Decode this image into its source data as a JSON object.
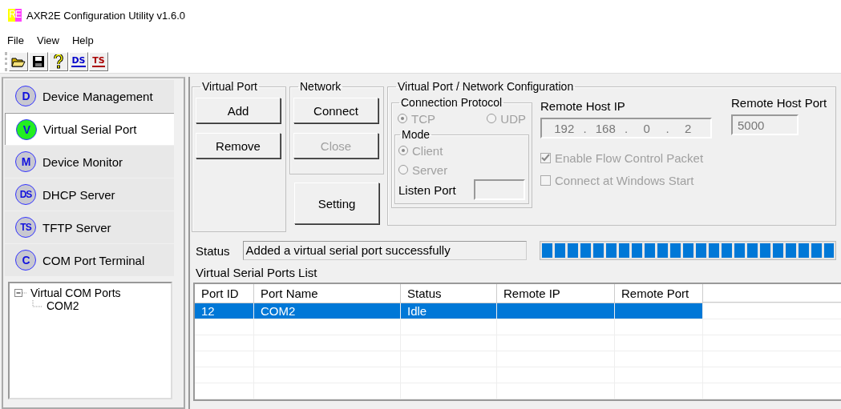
{
  "window": {
    "title": "AXR2E Configuration Utility v1.6.0",
    "logo": "RE"
  },
  "menu": [
    "File",
    "View",
    "Help"
  ],
  "toolbar": [
    {
      "kind": "open"
    },
    {
      "kind": "save"
    },
    {
      "kind": "help"
    },
    {
      "kind": "text",
      "label": "DS",
      "color": "#0000cc"
    },
    {
      "kind": "text",
      "label": "TS",
      "color": "#aa0000"
    }
  ],
  "sidebar": {
    "items": [
      {
        "badge": "D",
        "label": "Device Management",
        "selected": false
      },
      {
        "badge": "V",
        "label": "Virtual Serial Port",
        "selected": true
      },
      {
        "badge": "M",
        "label": "Device Monitor",
        "selected": false
      },
      {
        "badge": "DS",
        "label": "DHCP Server",
        "selected": false
      },
      {
        "badge": "TS",
        "label": "TFTP Server",
        "selected": false
      },
      {
        "badge": "C",
        "label": "COM Port Terminal",
        "selected": false
      }
    ],
    "tree": [
      {
        "label": "Virtual COM Ports",
        "expanded": true,
        "children": [
          {
            "label": "COM2"
          }
        ]
      }
    ]
  },
  "virtual_port": {
    "title": "Virtual Port",
    "buttons": [
      {
        "label": "Add",
        "disabled": false
      },
      {
        "label": "Remove",
        "disabled": false
      }
    ]
  },
  "network": {
    "title": "Network",
    "buttons": [
      {
        "label": "Connect",
        "disabled": false
      },
      {
        "label": "Close",
        "disabled": true
      }
    ],
    "setting_button": {
      "label": "Setting",
      "disabled": false
    }
  },
  "configuration": {
    "title": "Virtual Port / Network Configuration",
    "protocol": {
      "title": "Connection Protocol",
      "options": [
        {
          "label": "TCP",
          "selected": true,
          "disabled": true
        },
        {
          "label": "UDP",
          "selected": false,
          "disabled": true
        }
      ]
    },
    "mode": {
      "title": "Mode",
      "options": [
        {
          "label": "Client",
          "selected": true,
          "disabled": true
        },
        {
          "label": "Server",
          "selected": false,
          "disabled": true
        }
      ],
      "listen_port_label": "Listen Port"
    },
    "remote_host_ip": {
      "label": "Remote Host IP",
      "octets": [
        "192",
        "168",
        "0",
        "2"
      ],
      "separator": "."
    },
    "remote_host_port": {
      "label": "Remote Host Port",
      "value": "5000"
    },
    "checkboxes": [
      {
        "label": "Enable Flow Control Packet",
        "checked": true,
        "disabled": true
      },
      {
        "label": "Connect at Windows Start",
        "checked": false,
        "disabled": true
      }
    ]
  },
  "status": {
    "label": "Status",
    "message": "Added a virtual serial port successfully",
    "level": 1
  },
  "table": {
    "title": "Virtual Serial Ports List",
    "columns": [
      "Port ID",
      "Port Name",
      "Status",
      "Remote IP",
      "Remote Port"
    ],
    "rows": [
      {
        "cells": [
          "12",
          "COM2",
          "Idle",
          "",
          ""
        ],
        "selected": true
      }
    ]
  }
}
